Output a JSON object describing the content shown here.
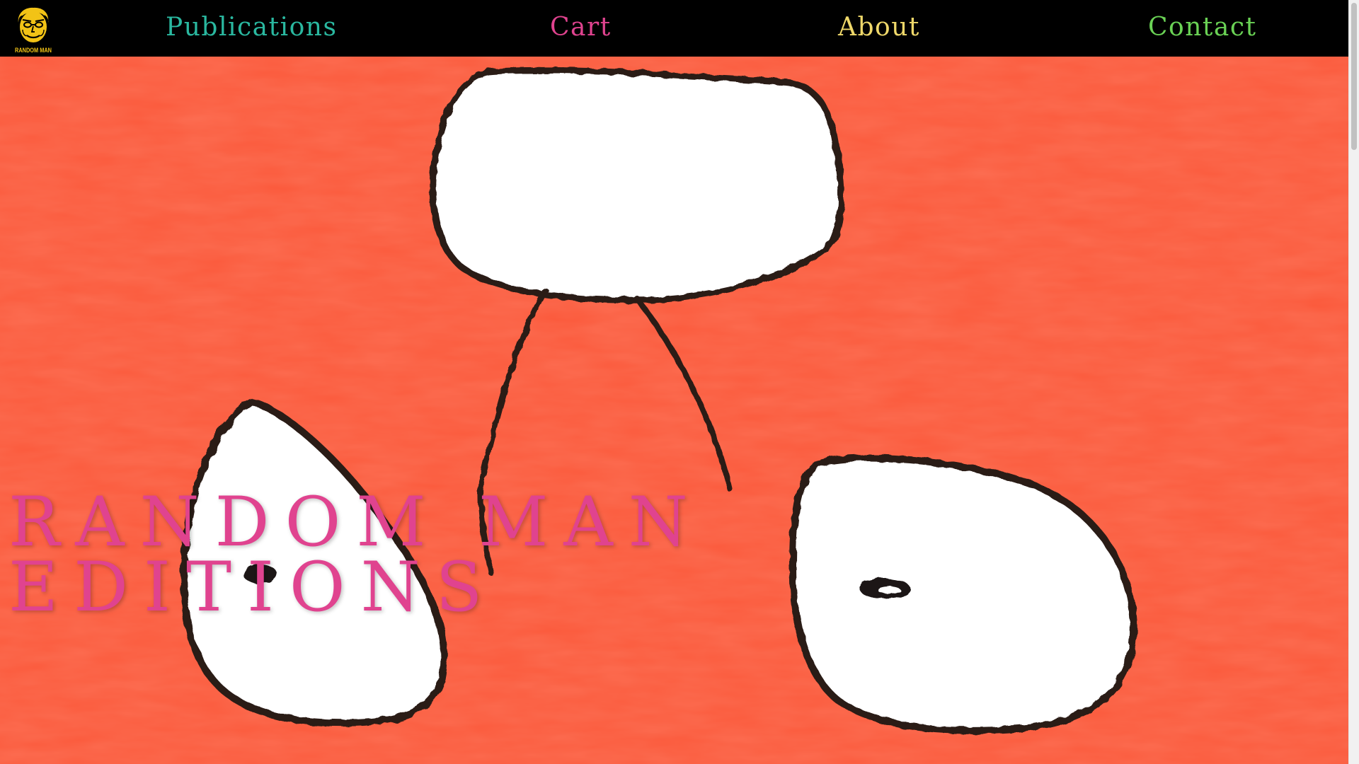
{
  "logo": {
    "text": "RANDOM MAN",
    "color": "#f2c316"
  },
  "nav": {
    "publications": {
      "label": "Publications",
      "color": "#2ab8a0"
    },
    "cart": {
      "label": "Cart",
      "color": "#e0438f"
    },
    "about": {
      "label": "About",
      "color": "#efd86a"
    },
    "contact": {
      "label": "Contact",
      "color": "#6ad255"
    }
  },
  "hero": {
    "title_line1": "RANDOM MAN",
    "title_line2": "EDITIONS",
    "title_color": "#e0438f",
    "background_color": "#fb5a3c",
    "artwork": "red-painting-with-white-blobs"
  },
  "colors": {
    "navbar_bg": "#000000",
    "scrollbar_track": "#f1f1f1",
    "scrollbar_thumb": "#c1c1c1"
  }
}
